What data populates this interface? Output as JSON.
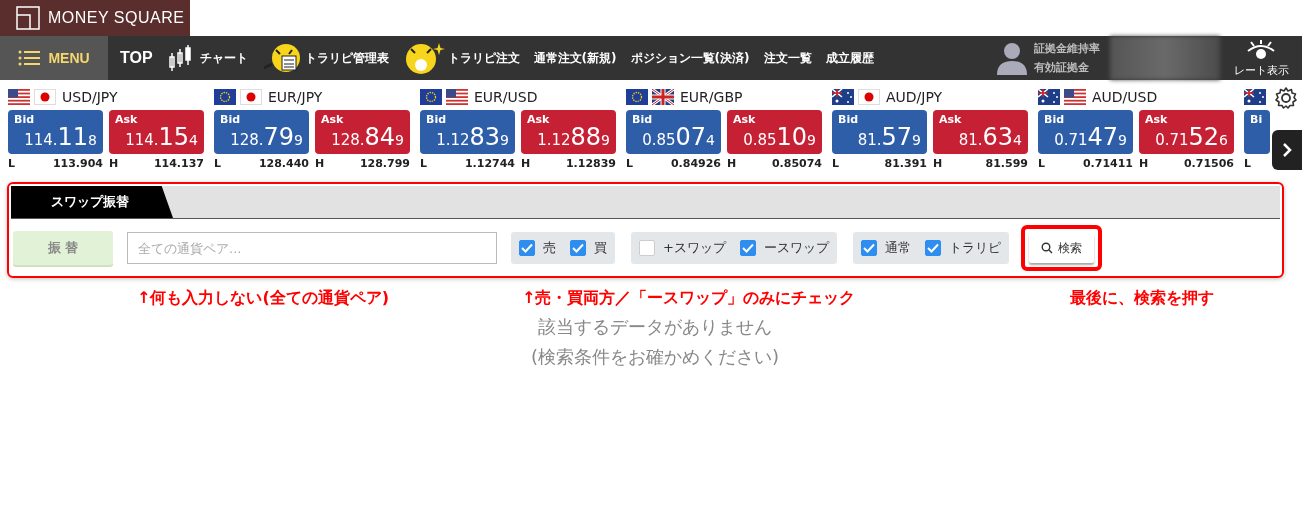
{
  "logo": {
    "text": "MONEY SQUARE"
  },
  "nav": {
    "menu": "MENU",
    "items": [
      {
        "label": "TOP"
      },
      {
        "label": "チャート"
      },
      {
        "label": "トラリピ管理表"
      },
      {
        "label": "トラリピ注文"
      },
      {
        "label": "通常注文(新規)"
      },
      {
        "label": "ポジション一覧(決済)"
      },
      {
        "label": "注文一覧"
      },
      {
        "label": "成立履歴"
      }
    ],
    "account": {
      "labels": [
        "証拠金維持率",
        "有効証拠金"
      ]
    },
    "rate_toggle": "レート表示"
  },
  "tickers": [
    {
      "pair": "USD/JPY",
      "bid": {
        "label": "Bid",
        "pre": "114.",
        "big": "11",
        "pip": "8"
      },
      "ask": {
        "label": "Ask",
        "pre": "114.",
        "big": "15",
        "pip": "4"
      },
      "low_label": "L",
      "low": "113.904",
      "high_label": "H",
      "high": "114.137"
    },
    {
      "pair": "EUR/JPY",
      "bid": {
        "label": "Bid",
        "pre": "128.",
        "big": "79",
        "pip": "9"
      },
      "ask": {
        "label": "Ask",
        "pre": "128.",
        "big": "84",
        "pip": "9"
      },
      "low_label": "L",
      "low": "128.440",
      "high_label": "H",
      "high": "128.799"
    },
    {
      "pair": "EUR/USD",
      "bid": {
        "label": "Bid",
        "pre": "1.12",
        "big": "83",
        "pip": "9"
      },
      "ask": {
        "label": "Ask",
        "pre": "1.12",
        "big": "88",
        "pip": "9"
      },
      "low_label": "L",
      "low": "1.12744",
      "high_label": "H",
      "high": "1.12839"
    },
    {
      "pair": "EUR/GBP",
      "bid": {
        "label": "Bid",
        "pre": "0.85",
        "big": "07",
        "pip": "4"
      },
      "ask": {
        "label": "Ask",
        "pre": "0.85",
        "big": "10",
        "pip": "9"
      },
      "low_label": "L",
      "low": "0.84926",
      "high_label": "H",
      "high": "0.85074"
    },
    {
      "pair": "AUD/JPY",
      "bid": {
        "label": "Bid",
        "pre": "81.",
        "big": "57",
        "pip": "9"
      },
      "ask": {
        "label": "Ask",
        "pre": "81.",
        "big": "63",
        "pip": "4"
      },
      "low_label": "L",
      "low": "81.391",
      "high_label": "H",
      "high": "81.599"
    },
    {
      "pair": "AUD/USD",
      "bid": {
        "label": "Bid",
        "pre": "0.71",
        "big": "47",
        "pip": "9"
      },
      "ask": {
        "label": "Ask",
        "pre": "0.71",
        "big": "52",
        "pip": "6"
      },
      "low_label": "L",
      "low": "0.71411",
      "high_label": "H",
      "high": "0.71506"
    },
    {
      "bid": {
        "label": "Bi"
      },
      "low_label": "L"
    }
  ],
  "panel": {
    "tabs": [
      {
        "label": "スワップ振替",
        "selected": true
      }
    ],
    "transfer_button": {
      "label": "振 替",
      "disabled": true
    },
    "pair_field": {
      "placeholder": "全ての通貨ペア..."
    },
    "groups": [
      [
        {
          "label": "売",
          "checked": true
        },
        {
          "label": "買",
          "checked": true
        }
      ],
      [
        {
          "label": "+スワップ",
          "checked": false
        },
        {
          "label": "ースワップ",
          "checked": true
        }
      ],
      [
        {
          "label": "通常",
          "checked": true
        },
        {
          "label": "トラリピ",
          "checked": true
        }
      ]
    ],
    "search_button": "検索"
  },
  "empty_message": [
    "該当するデータがありません",
    "(検索条件をお確かめください)"
  ],
  "annotations": [
    {
      "text": "↑何も入力しない(全ての通貨ペア)"
    },
    {
      "text": "↑売・買両方／「ースワップ」のみにチェック"
    },
    {
      "text": "最後に、検索を押す"
    }
  ]
}
